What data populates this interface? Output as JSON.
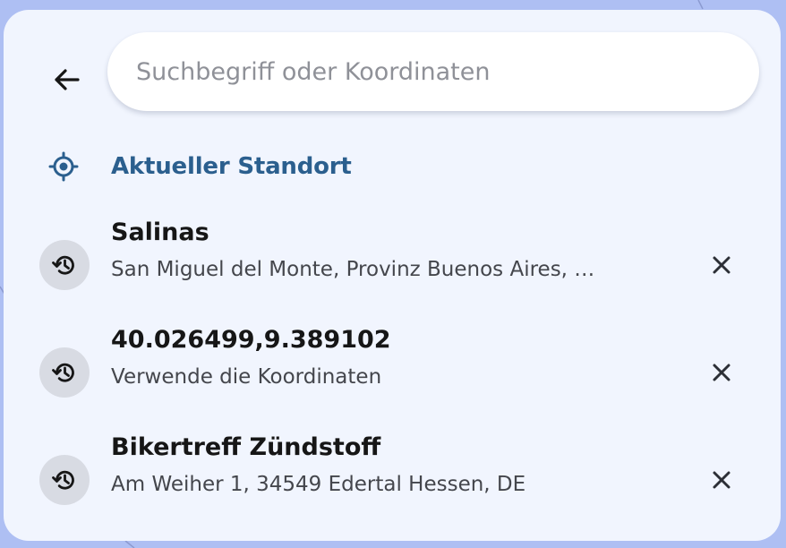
{
  "search": {
    "placeholder": "Suchbegriff oder Koordinaten",
    "value": ""
  },
  "icons": {
    "back": "arrow-left-icon",
    "current_location": "gps-crosshair-icon",
    "history": "history-icon",
    "remove": "close-icon"
  },
  "current_location": {
    "label": "Aktueller Standort",
    "color": "#2b5f8e"
  },
  "recent": [
    {
      "title": "Salinas",
      "subtitle": "San Miguel del Monte, Provinz Buenos Aires, …"
    },
    {
      "title": "40.026499,9.389102",
      "subtitle": "Verwende die Koordinaten"
    },
    {
      "title": "Bikertreff Zündstoff",
      "subtitle": "Am Weiher 1, 34549 Edertal Hessen, DE"
    }
  ],
  "colors": {
    "panel_bg": "#f1f5fe",
    "map_bg": "#aebff3",
    "accent": "#2b5f8e"
  }
}
